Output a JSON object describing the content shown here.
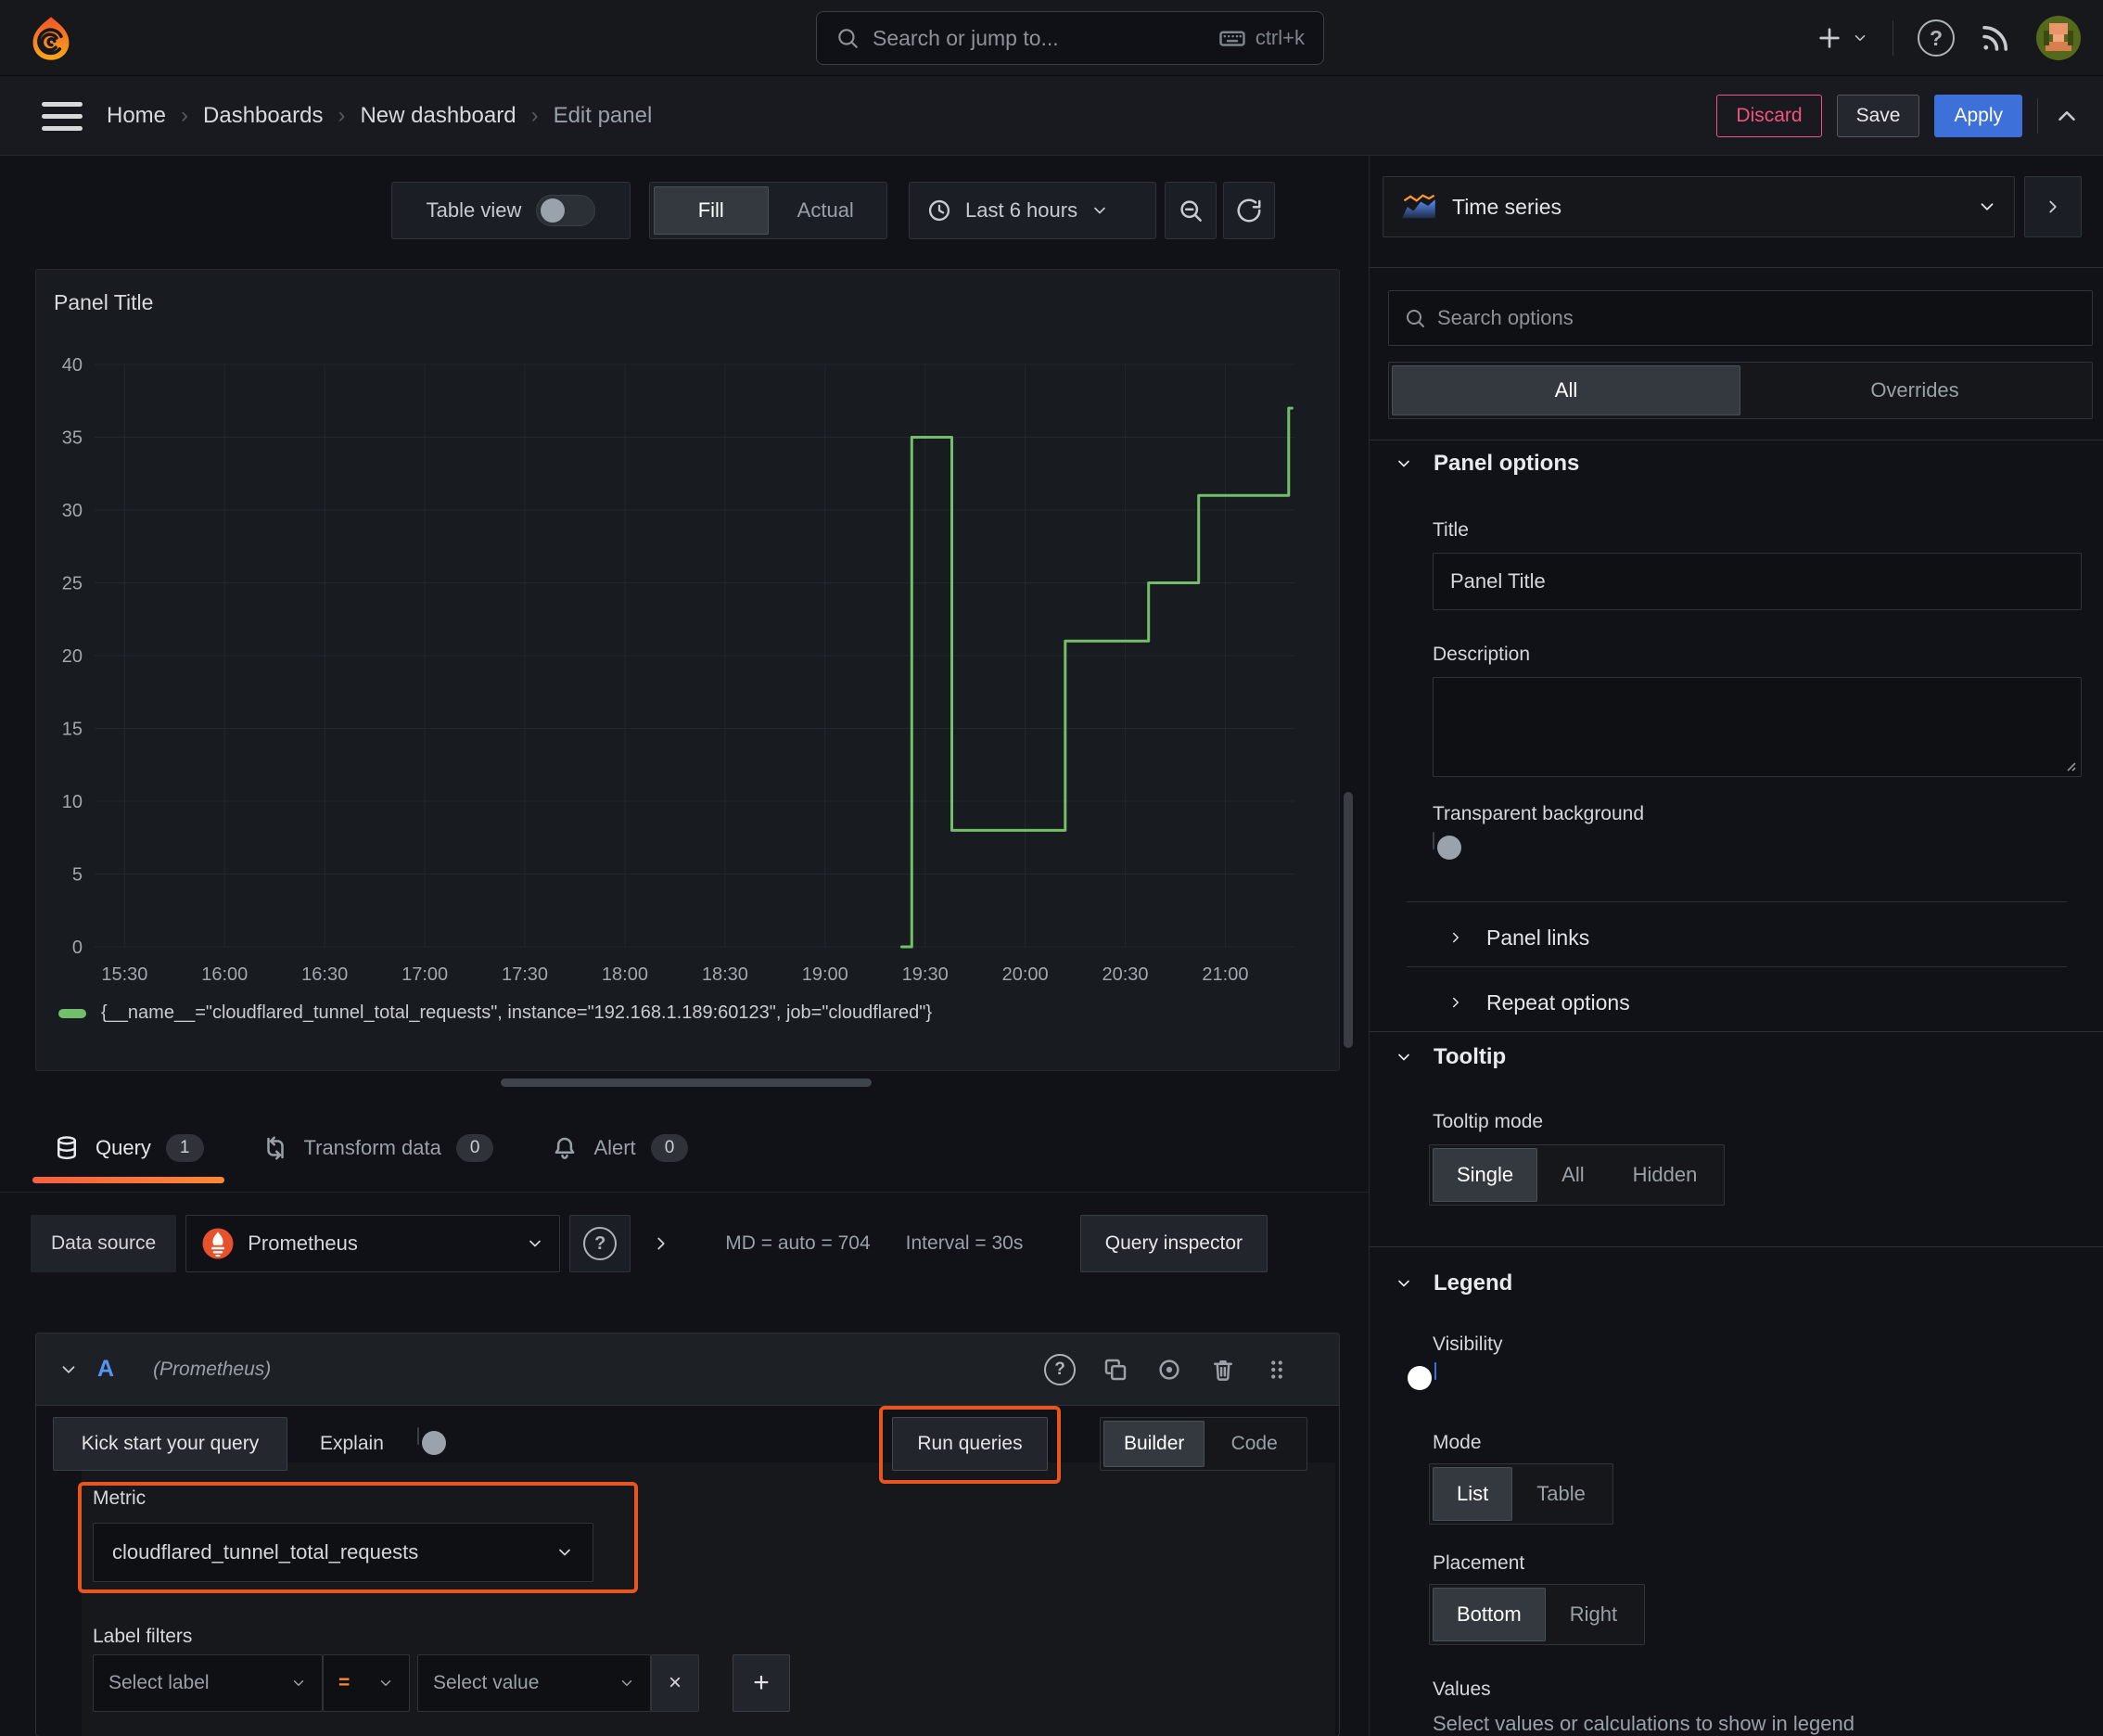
{
  "topbar": {
    "search_placeholder": "Search or jump to...",
    "search_shortcut": "ctrl+k"
  },
  "breadcrumb": {
    "items": [
      "Home",
      "Dashboards",
      "New dashboard",
      "Edit panel"
    ]
  },
  "header_actions": {
    "discard": "Discard",
    "save": "Save",
    "apply": "Apply"
  },
  "panel_toolbar": {
    "table_view_label": "Table view",
    "fill_label": "Fill",
    "actual_label": "Actual",
    "time_range": "Last 6 hours"
  },
  "viz_picker": {
    "label": "Time series"
  },
  "panel": {
    "title": "Panel Title"
  },
  "chart_data": {
    "type": "line",
    "line_style": "step-after",
    "color": "#73BF69",
    "title": "Panel Title",
    "x_axis": {
      "start": "15:21",
      "end": "21:21",
      "ticks": [
        "15:30",
        "16:00",
        "16:30",
        "17:00",
        "17:30",
        "18:00",
        "18:30",
        "19:00",
        "19:30",
        "20:00",
        "20:30",
        "21:00"
      ]
    },
    "y_axis": {
      "min": 0,
      "max": 40,
      "tick_step": 5,
      "ticks": [
        0,
        5,
        10,
        15,
        20,
        25,
        30,
        35,
        40
      ]
    },
    "grid": true,
    "legend_position": "bottom",
    "series": [
      {
        "name": "{__name__=\"cloudflared_tunnel_total_requests\", instance=\"192.168.1.189:60123\", job=\"cloudflared\"}",
        "points": [
          [
            "19:23",
            0
          ],
          [
            "19:26",
            0
          ],
          [
            "19:26",
            35
          ],
          [
            "19:38",
            35
          ],
          [
            "19:38",
            8
          ],
          [
            "20:12",
            8
          ],
          [
            "20:12",
            21
          ],
          [
            "20:37",
            21
          ],
          [
            "20:37",
            25
          ],
          [
            "20:52",
            25
          ],
          [
            "20:52",
            31
          ],
          [
            "21:19",
            31
          ],
          [
            "21:19",
            37
          ],
          [
            "21:20",
            37
          ]
        ]
      }
    ]
  },
  "editor_tabs": [
    {
      "label": "Query",
      "count": "1"
    },
    {
      "label": "Transform data",
      "count": "0"
    },
    {
      "label": "Alert",
      "count": "0"
    }
  ],
  "datasource_row": {
    "label": "Data source",
    "name": "Prometheus",
    "options_summary": "MD = auto = 704",
    "interval": "Interval = 30s",
    "inspector_label": "Query inspector"
  },
  "query_editor": {
    "ref_id": "A",
    "datasource_hint": "(Prometheus)",
    "kickstart_label": "Kick start your query",
    "explain_label": "Explain",
    "run_label": "Run queries",
    "builder_label": "Builder",
    "code_label": "Code",
    "metric_label": "Metric",
    "metric_value": "cloudflared_tunnel_total_requests",
    "label_filters_label": "Label filters",
    "select_label_placeholder": "Select label",
    "operator": "=",
    "select_value_placeholder": "Select value"
  },
  "options_pane": {
    "search_placeholder": "Search options",
    "filter_tabs": [
      "All",
      "Overrides"
    ],
    "panel_options": {
      "title": "Panel options",
      "title_label": "Title",
      "title_value": "Panel Title",
      "description_label": "Description",
      "transparent_label": "Transparent background",
      "panel_links": "Panel links",
      "repeat_options": "Repeat options"
    },
    "tooltip": {
      "title": "Tooltip",
      "mode_label": "Tooltip mode",
      "options": [
        "Single",
        "All",
        "Hidden"
      ],
      "selected": "Single"
    },
    "legend": {
      "title": "Legend",
      "visibility_label": "Visibility",
      "mode_label": "Mode",
      "mode_options": [
        "List",
        "Table"
      ],
      "mode_selected": "List",
      "placement_label": "Placement",
      "placement_options": [
        "Bottom",
        "Right"
      ],
      "placement_selected": "Bottom",
      "values_label": "Values",
      "values_description": "Select values or calculations to show in legend"
    }
  },
  "colors": {
    "accent_orange": "#E8551E",
    "apply_blue": "#3D71D9",
    "series_green": "#73BF69"
  }
}
